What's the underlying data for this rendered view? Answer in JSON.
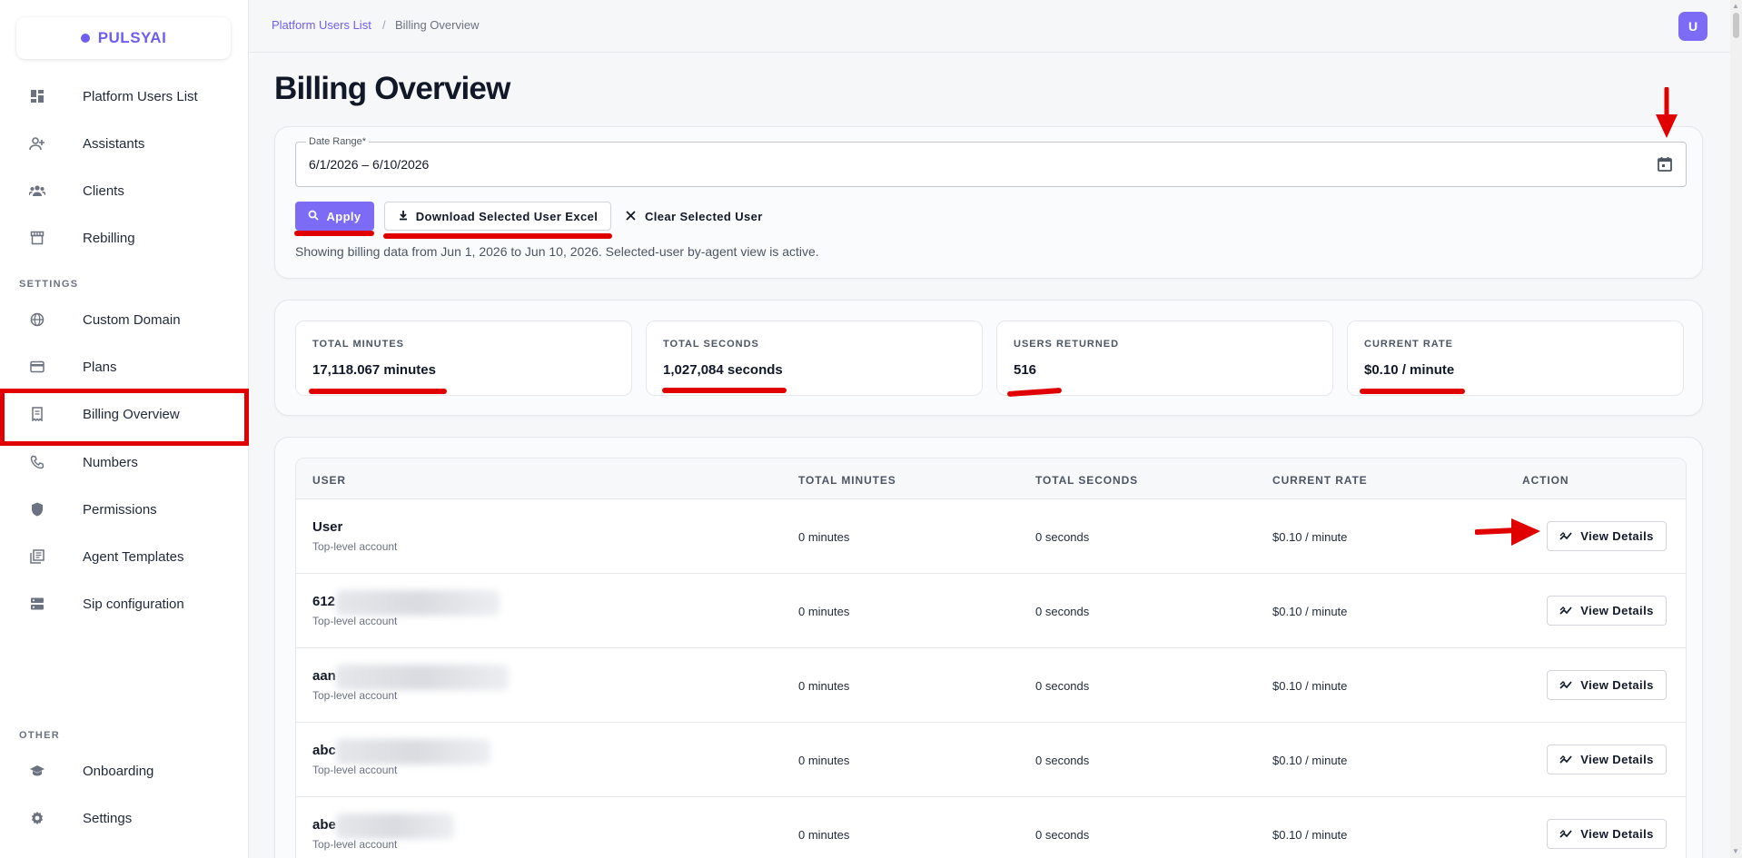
{
  "app": {
    "brand": "PULSYAI"
  },
  "sidebar": {
    "items": [
      {
        "label": "Platform Users List",
        "icon": "dashboard-icon"
      },
      {
        "label": "Assistants",
        "icon": "person-add-icon"
      },
      {
        "label": "Clients",
        "icon": "group-icon"
      },
      {
        "label": "Rebilling",
        "icon": "storefront-icon"
      }
    ],
    "settings_header": "SETTINGS",
    "settings_items": [
      {
        "label": "Custom Domain",
        "icon": "globe-icon"
      },
      {
        "label": "Plans",
        "icon": "credit-card-icon"
      },
      {
        "label": "Billing Overview",
        "icon": "receipt-icon"
      },
      {
        "label": "Numbers",
        "icon": "phone-icon"
      },
      {
        "label": "Permissions",
        "icon": "shield-icon"
      },
      {
        "label": "Agent Templates",
        "icon": "library-icon"
      },
      {
        "label": "Sip configuration",
        "icon": "storage-icon"
      }
    ],
    "other_header": "OTHER",
    "other_items": [
      {
        "label": "Onboarding",
        "icon": "school-icon"
      },
      {
        "label": "Settings",
        "icon": "gear-icon"
      }
    ]
  },
  "header": {
    "breadcrumb": [
      "Platform Users List",
      "Billing Overview"
    ],
    "breadcrumb_sep": "/",
    "avatar": "U"
  },
  "page": {
    "title": "Billing Overview"
  },
  "filters": {
    "date_label": "Date Range*",
    "date_value": "6/1/2026  – 6/10/2026",
    "apply": "Apply",
    "download": "Download Selected User Excel",
    "clear": "Clear Selected User",
    "note": "Showing billing data from Jun 1, 2026 to Jun 10, 2026. Selected-user by-agent view is active."
  },
  "stats": [
    {
      "label": "TOTAL MINUTES",
      "value": "17,118.067 minutes"
    },
    {
      "label": "TOTAL SECONDS",
      "value": "1,027,084 seconds"
    },
    {
      "label": "USERS RETURNED",
      "value": "516"
    },
    {
      "label": "CURRENT RATE",
      "value": "$0.10 / minute"
    }
  ],
  "table": {
    "columns": [
      "USER",
      "TOTAL MINUTES",
      "TOTAL SECONDS",
      "CURRENT RATE",
      "ACTION"
    ],
    "rows": [
      {
        "name": "User",
        "sub": "Top-level account",
        "minutes": "0 minutes",
        "seconds": "0 seconds",
        "rate": "$0.10 / minute",
        "action": "View Details"
      },
      {
        "name": "612",
        "sub": "Top-level account",
        "minutes": "0 minutes",
        "seconds": "0 seconds",
        "rate": "$0.10 / minute",
        "action": "View Details"
      },
      {
        "name": "aan",
        "sub": "Top-level account",
        "minutes": "0 minutes",
        "seconds": "0 seconds",
        "rate": "$0.10 / minute",
        "action": "View Details"
      },
      {
        "name": "abc",
        "sub": "Top-level account",
        "minutes": "0 minutes",
        "seconds": "0 seconds",
        "rate": "$0.10 / minute",
        "action": "View Details"
      },
      {
        "name": "abe",
        "sub": "Top-level account",
        "minutes": "0 minutes",
        "seconds": "0 seconds",
        "rate": "$0.10 / minute",
        "action": "View Details"
      }
    ]
  },
  "colors": {
    "accent": "#7c6cf5",
    "brand": "#6d5ef0",
    "annotation": "#e10000"
  }
}
